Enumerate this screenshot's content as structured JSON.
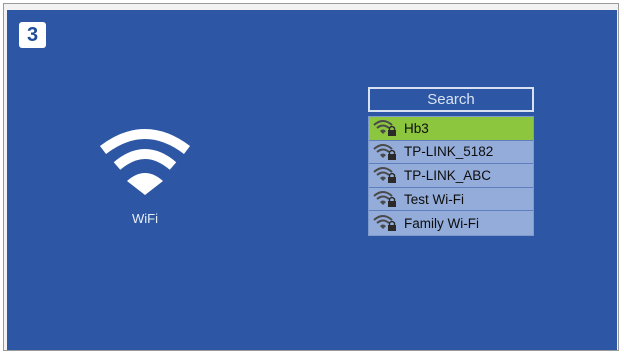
{
  "step": {
    "number": "3"
  },
  "wifi": {
    "label": "WiFi"
  },
  "search": {
    "label": "Search"
  },
  "networks": [
    {
      "name": "Hb3",
      "selected": true,
      "icon": "wifi-lock-icon"
    },
    {
      "name": "TP-LINK_5182",
      "selected": false,
      "icon": "wifi-lock-icon"
    },
    {
      "name": "TP-LINK_ABC",
      "selected": false,
      "icon": "wifi-lock-icon"
    },
    {
      "name": "Test Wi-Fi",
      "selected": false,
      "icon": "wifi-lock-icon"
    },
    {
      "name": "Family Wi-Fi",
      "selected": false,
      "icon": "wifi-lock-icon"
    }
  ],
  "colors": {
    "background": "#2d57a5",
    "list": "#93acd9",
    "selected": "#8cc63f"
  }
}
